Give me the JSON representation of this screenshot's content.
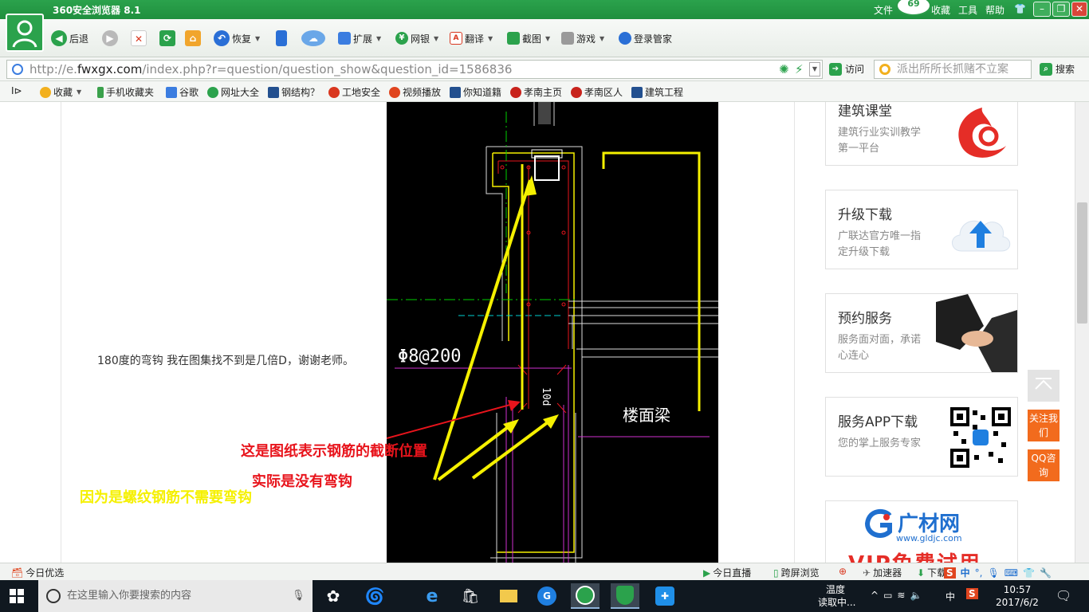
{
  "browser": {
    "title": "360安全浏览器 8.1",
    "menu": [
      "文件",
      "收藏",
      "工具",
      "帮助"
    ],
    "notification_count": "69"
  },
  "toolbar": {
    "back": "后退",
    "restore": "恢复",
    "extend": "扩展",
    "ebank": "网银",
    "translate": "翻译",
    "screenshot": "截图",
    "games": "游戏",
    "login_manager": "登录管家"
  },
  "address": {
    "url_prefix": "http://e.",
    "url_host": "fwxgx.com",
    "url_path": "/index.php?r=question/question_show&question_id=1586836",
    "go_label": "访问",
    "search_placeholder": "派出所所长抓赌不立案",
    "search_label": "搜索"
  },
  "bookmarks": [
    {
      "label": "收藏",
      "color": "#f2b01e"
    },
    {
      "label": "手机收藏夹",
      "color": "#3aa14b"
    },
    {
      "label": "谷歌",
      "color": "#3b7de0"
    },
    {
      "label": "网址大全",
      "color": "#2ba24c"
    },
    {
      "label": "钢结构？",
      "color": "#23508f"
    },
    {
      "label": "工地安全",
      "color": "#d9371f"
    },
    {
      "label": "视频播放",
      "color": "#e0451f"
    },
    {
      "label": "你知道籍",
      "color": "#23508f"
    },
    {
      "label": "孝南主页",
      "color": "#c8231c"
    },
    {
      "label": "孝南区人",
      "color": "#c8231c"
    },
    {
      "label": "建筑工程",
      "color": "#23508f"
    }
  ],
  "content": {
    "question": "180度的弯钩 我在图集找不到是几倍D，谢谢老师。",
    "cad_labels": {
      "rebar": "Φ8@200",
      "dim": "10d",
      "beam": "楼面梁"
    },
    "annotations": {
      "red": "这是图纸表示钢筋的截断位置",
      "red2": "实际是没有弯钩",
      "yellow": "因为是螺纹钢筋不需要弯钩"
    },
    "colors": {
      "red": "#e8141c",
      "yellow": "#f5f000"
    }
  },
  "sidebar": {
    "cards": [
      {
        "title": "建筑课堂",
        "sub": "建筑行业实训教学第一平台"
      },
      {
        "title": "升级下载",
        "sub": "广联达官方唯一指定升级下载"
      },
      {
        "title": "预约服务",
        "sub": "服务面对面，承诺心连心"
      },
      {
        "title": "服务APP下载",
        "sub": "您的掌上服务专家"
      }
    ],
    "gc_logo": "广材网",
    "gc_url": "www.gldjc.com",
    "gc_banner": "VIP免费试用",
    "follow": "关注我们",
    "qq": "QQ咨询"
  },
  "status": {
    "today": "今日优选",
    "live": "今日直播",
    "cross_screen": "跨屏浏览",
    "accelerator": "加速器",
    "download": "下载"
  },
  "taskbar": {
    "search_placeholder": "在这里输入你要搜索的内容",
    "weather": "温度",
    "weather_sub": "读取中...",
    "ime": "中",
    "time": "10:57",
    "date": "2017/6/2"
  }
}
